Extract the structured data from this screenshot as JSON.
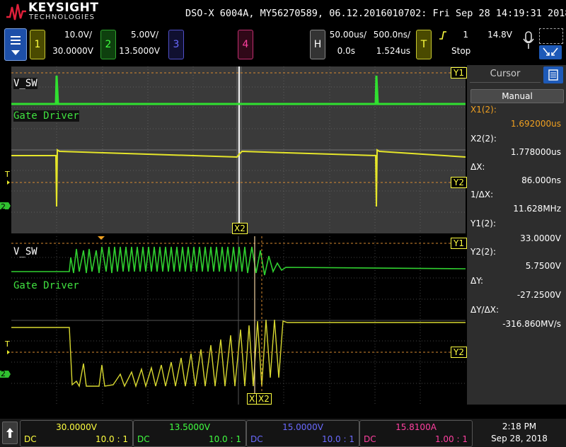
{
  "header": {
    "brand": "KEYSIGHT",
    "brand_sub": "TECHNOLOGIES",
    "info": "DSO-X 6004A, MY56270589, 06.12.2016010702: Fri Sep 28 14:19:31 2018"
  },
  "channels": [
    {
      "num": "1",
      "scale": "10.0V/",
      "offset": "30.0000V",
      "color": "#ffff40"
    },
    {
      "num": "2",
      "scale": "5.00V/",
      "offset": "13.5000V",
      "color": "#40ff40"
    },
    {
      "num": "3",
      "scale": "",
      "offset": "",
      "color": "#6a6aff"
    },
    {
      "num": "4",
      "scale": "",
      "offset": "",
      "color": "#ff40a0"
    }
  ],
  "horizontal": {
    "label": "H",
    "scale": "50.00us/",
    "delay": "0.0s",
    "zoom_scale": "500.0ns/",
    "zoom_delay": "1.524us"
  },
  "trigger": {
    "label": "T",
    "source": "1",
    "level": "14.8V",
    "status": "Stop"
  },
  "traces": {
    "ch2_name": "V_SW",
    "ch1_name": "Gate Driver"
  },
  "markers": {
    "y1": "Y1",
    "y2": "Y2",
    "x1": "X1",
    "x2": "X2",
    "t": "T",
    "ch2": "2",
    "ch1": "1"
  },
  "cursor_panel": {
    "title": "Cursor",
    "mode": "Manual",
    "x1_label": "X1(2):",
    "x1_value": "1.692000us",
    "x2_label": "X2(2):",
    "x2_value": "1.778000us",
    "dx_label": "ΔX:",
    "dx_value": "86.000ns",
    "inv_dx_label": "1/ΔX:",
    "inv_dx_value": "11.628MHz",
    "y1_label": "Y1(2):",
    "y1_value": "33.0000V",
    "y2_label": "Y2(2):",
    "y2_value": "5.7500V",
    "dy_label": "ΔY:",
    "dy_value": "-27.2500V",
    "dydx_label": "ΔY/ΔX:",
    "dydx_value": "-316.860MV/s"
  },
  "footer": {
    "ch1": {
      "offset": "30.0000V",
      "coupling": "DC",
      "ratio": "10.0 : 1",
      "color": "#ffff40"
    },
    "ch2": {
      "offset": "13.5000V",
      "coupling": "DC",
      "ratio": "10.0 : 1",
      "color": "#40ff40"
    },
    "ch3": {
      "offset": "15.0000V",
      "coupling": "DC",
      "ratio": "10.0 : 1",
      "color": "#6a6aff"
    },
    "ch4": {
      "offset": "15.8100A",
      "coupling": "DC",
      "ratio": "1.00 : 1",
      "color": "#ff40a0"
    },
    "time": "2:18 PM",
    "date": "Sep 28, 2018"
  }
}
